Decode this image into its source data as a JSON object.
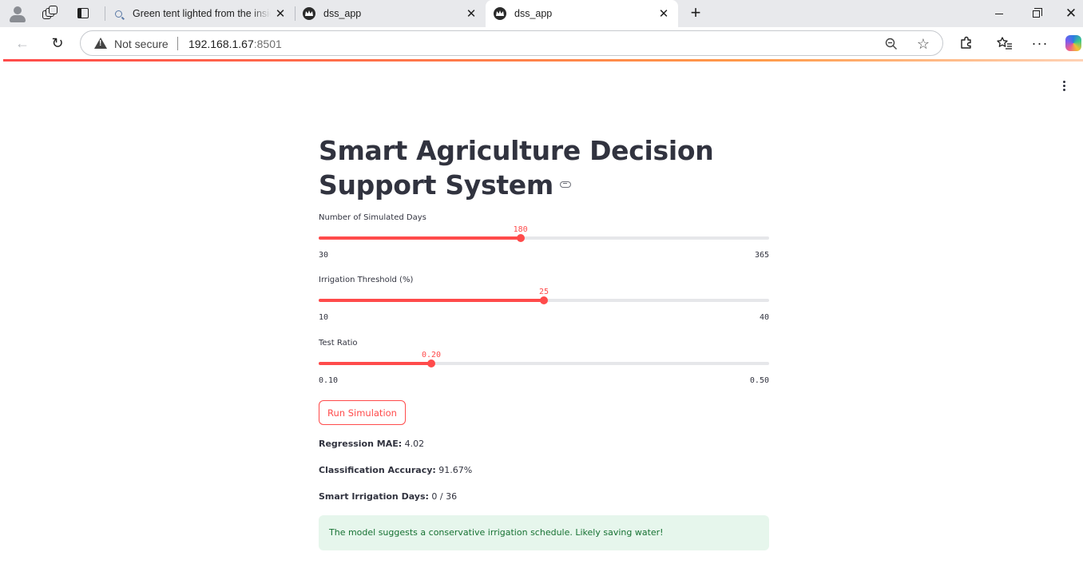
{
  "browser": {
    "tabs": [
      {
        "title": "Green tent lighted from the inside",
        "active": false
      },
      {
        "title": "dss_app",
        "active": false
      },
      {
        "title": "dss_app",
        "active": true
      }
    ],
    "address": {
      "security_label": "Not secure",
      "host": "192.168.1.67",
      "port": ":8501"
    }
  },
  "app": {
    "title": "Smart Agriculture Decision Support System",
    "sliders": [
      {
        "label": "Number of Simulated Days",
        "value": "180",
        "min": "30",
        "max": "365",
        "fraction": 0.448
      },
      {
        "label": "Irrigation Threshold (%)",
        "value": "25",
        "min": "10",
        "max": "40",
        "fraction": 0.5
      },
      {
        "label": "Test Ratio",
        "value": "0.20",
        "min": "0.10",
        "max": "0.50",
        "fraction": 0.25
      }
    ],
    "run_button": "Run Simulation",
    "metrics": [
      {
        "label": "Regression MAE:",
        "value": " 4.02"
      },
      {
        "label": "Classification Accuracy:",
        "value": " 91.67%"
      },
      {
        "label": "Smart Irrigation Days:",
        "value": " 0 / 36"
      }
    ],
    "alert": "The model suggests a conservative irrigation schedule. Likely saving water!",
    "colors": {
      "accent": "#ff4b4b",
      "text": "#31333f",
      "success_bg": "#e6f6ec",
      "success_text": "#177233"
    }
  }
}
